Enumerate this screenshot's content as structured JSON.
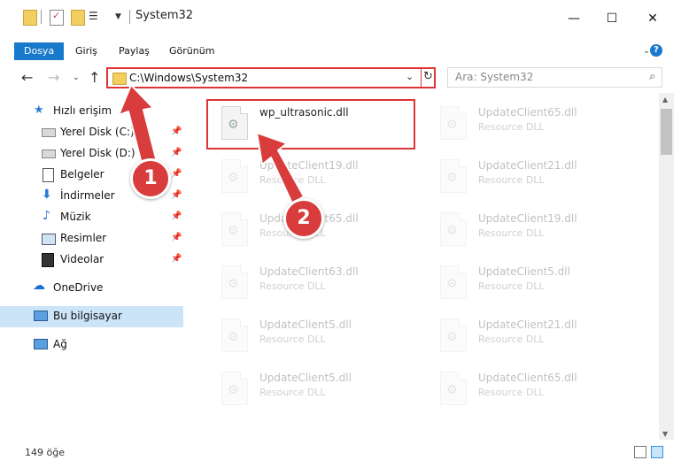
{
  "window": {
    "title": "System32",
    "minimize_glyph": "—",
    "maximize_glyph": "☐",
    "close_glyph": "✕"
  },
  "ribbon": {
    "tabs": [
      "Dosya",
      "Giriş",
      "Paylaş",
      "Görünüm"
    ],
    "help_glyph": "?"
  },
  "address": {
    "path": "C:\\Windows\\System32"
  },
  "search": {
    "placeholder": "Ara: System32"
  },
  "sidebar": {
    "quick_access": "Hızlı erişim",
    "items": [
      {
        "label": "Yerel Disk (C:)",
        "pinned": true
      },
      {
        "label": "Yerel Disk (D:)",
        "pinned": true
      },
      {
        "label": "Belgeler",
        "pinned": true
      },
      {
        "label": "İndirmeler",
        "pinned": true
      },
      {
        "label": "Müzik",
        "pinned": true
      },
      {
        "label": "Resimler",
        "pinned": true
      },
      {
        "label": "Videolar",
        "pinned": true
      }
    ],
    "onedrive": "OneDrive",
    "thispc": "Bu bilgisayar",
    "network": "Ağ"
  },
  "files": [
    {
      "name": "wp_ultrasonic.dll",
      "type": ""
    },
    {
      "name": "UpdateClient65.dll",
      "type": "Resource DLL"
    },
    {
      "name": "UpdateClient19.dll",
      "type": "Resource DLL"
    },
    {
      "name": "UpdateClient21.dll",
      "type": "Resource DLL"
    },
    {
      "name": "UpdateClient65.dll",
      "type": "Resource DLL"
    },
    {
      "name": "UpdateClient19.dll",
      "type": "Resource DLL"
    },
    {
      "name": "UpdateClient63.dll",
      "type": "Resource DLL"
    },
    {
      "name": "UpdateClient5.dll",
      "type": "Resource DLL"
    },
    {
      "name": "UpdateClient5.dll",
      "type": "Resource DLL"
    },
    {
      "name": "UpdateClient21.dll",
      "type": "Resource DLL"
    },
    {
      "name": "UpdateClient5.dll",
      "type": "Resource DLL"
    },
    {
      "name": "UpdateClient65.dll",
      "type": "Resource DLL"
    }
  ],
  "status": {
    "count": "149 öğe"
  },
  "callouts": [
    "1",
    "2"
  ],
  "colors": {
    "accent": "#1979ca",
    "highlight_red": "#dd3535",
    "selected_nav": "#cce4f7"
  }
}
